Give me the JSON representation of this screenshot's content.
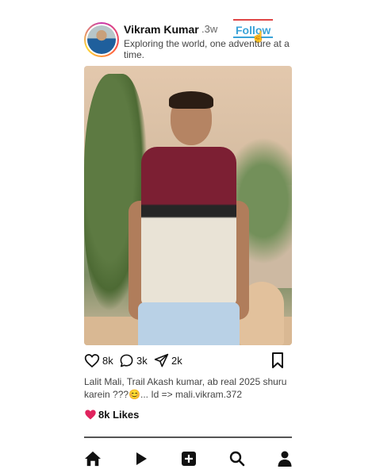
{
  "profile": {
    "username": "Vikram Kumar",
    "time_ago": ".3w",
    "follow_label": "Follow",
    "bio": "Exploring the world, one adventure at a time."
  },
  "post": {
    "likes_count": "8k",
    "comments_count": "3k",
    "shares_count": "2k",
    "caption": "Lalit Mali, Trail Akash kumar, ab real 2025 shuru karein ???😊... Id => mali.vikram.372",
    "likes_label": "8k Likes"
  },
  "icons": {
    "like": "heart-outline-icon",
    "comment": "speech-bubble-icon",
    "share": "paper-plane-icon",
    "bookmark": "bookmark-icon",
    "likes_heart": "filled-heart-icon"
  },
  "nav": [
    "home-icon",
    "play-icon",
    "add-icon",
    "search-icon",
    "profile-icon"
  ],
  "colors": {
    "follow": "#3aa3d8",
    "heart": "#e0245e",
    "avatar_ring": "#c837ab"
  }
}
